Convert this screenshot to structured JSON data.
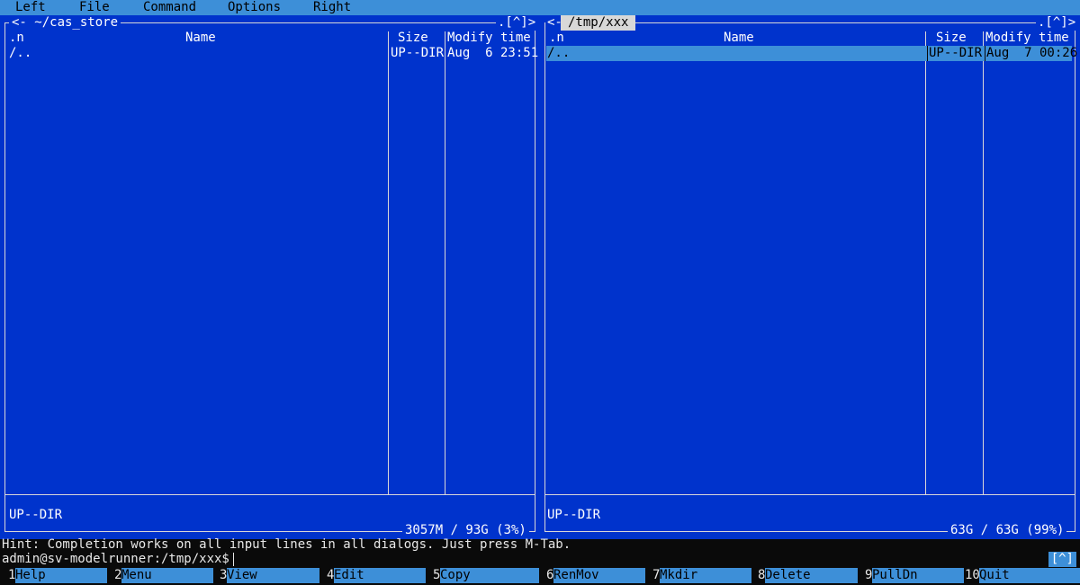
{
  "menubar": {
    "items": [
      "Left",
      "File",
      "Command",
      "Options",
      "Right"
    ]
  },
  "left_panel": {
    "path": "<- ~/cas_store",
    "corner": ".[^]>",
    "headers": {
      "name_prefix": ".n",
      "name": "Name",
      "size": "Size",
      "mtime": "Modify time"
    },
    "rows": [
      {
        "name": "/..",
        "size": "UP--DIR",
        "mtime": "Aug  6 23:51"
      }
    ],
    "status": "UP--DIR",
    "free": "3057M / 93G (3%)"
  },
  "right_panel": {
    "arrow": "<-",
    "path": "/tmp/xxx",
    "corner": ".[^]>",
    "headers": {
      "name_prefix": ".n",
      "name": "Name",
      "size": "Size",
      "mtime": "Modify time"
    },
    "rows": [
      {
        "name": "/..",
        "size": "UP--DIR",
        "mtime": "Aug  7 00:26"
      }
    ],
    "status": "UP--DIR",
    "free": "63G / 63G (99%)"
  },
  "hint": "Hint: Completion works on all input lines in all dialogs. Just press M-Tab.",
  "prompt": "admin@sv-modelrunner:/tmp/xxx$",
  "prompt_tag": "[^]",
  "fkeys": [
    {
      "num": "1",
      "label": "Help"
    },
    {
      "num": "2",
      "label": "Menu"
    },
    {
      "num": "3",
      "label": "View"
    },
    {
      "num": "4",
      "label": "Edit"
    },
    {
      "num": "5",
      "label": "Copy"
    },
    {
      "num": "6",
      "label": "RenMov"
    },
    {
      "num": "7",
      "label": "Mkdir"
    },
    {
      "num": "8",
      "label": "Delete"
    },
    {
      "num": "9",
      "label": "PullDn"
    },
    {
      "num": "10",
      "label": "Quit"
    }
  ],
  "colors": {
    "panel_bg": "#0033cc",
    "bar_bg": "#3d8fd8",
    "frame": "#d8d8d8",
    "terminal_bg": "#0a0a0a"
  }
}
